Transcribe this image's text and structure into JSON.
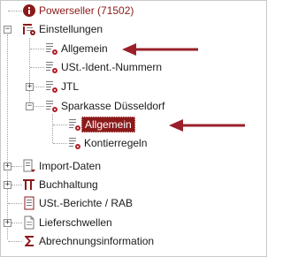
{
  "tree": {
    "powerseller": {
      "label": "Powerseller (71502)",
      "icon": "info-circle-icon"
    },
    "einstellungen": {
      "label": "Einstellungen",
      "expander": "−",
      "icon": "settings-table-icon"
    },
    "allgemein1": {
      "label": "Allgemein",
      "icon": "settings-gear-doc-icon"
    },
    "ustident": {
      "label": "USt.-Ident.-Nummern",
      "icon": "settings-gear-doc-icon"
    },
    "jtl": {
      "label": "JTL",
      "expander": "+",
      "icon": "settings-gear-doc-icon"
    },
    "sparkasse": {
      "label": "Sparkasse Düsseldorf",
      "expander": "−",
      "icon": "settings-gear-doc-icon"
    },
    "allgemein2": {
      "label": "Allgemein",
      "icon": "settings-gear-doc-icon"
    },
    "kontierregeln": {
      "label": "Kontierregeln",
      "icon": "settings-gear-doc-icon"
    },
    "import": {
      "label": "Import-Daten",
      "expander": "+",
      "icon": "import-doc-icon"
    },
    "buchhaltung": {
      "label": "Buchhaltung",
      "expander": "+",
      "icon": "ledger-table-icon"
    },
    "ustberichte": {
      "label": "USt.-Berichte / RAB",
      "icon": "report-doc-icon"
    },
    "lieferschwellen": {
      "label": "Lieferschwellen",
      "expander": "+",
      "icon": "document-icon"
    },
    "abrechnung": {
      "label": "Abrechnungsinformation",
      "icon": "sigma-icon"
    }
  },
  "colors": {
    "accent": "#8b1a1a",
    "selected_bg": "#8b1a1a",
    "arrow": "#9a1f2a"
  }
}
